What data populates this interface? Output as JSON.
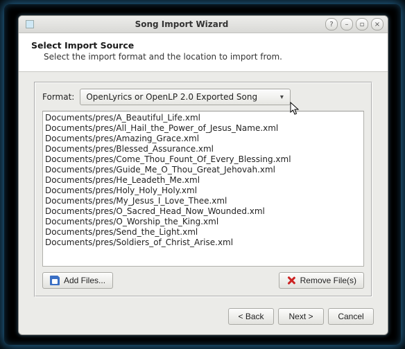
{
  "window": {
    "title": "Song Import Wizard"
  },
  "header": {
    "heading": "Select Import Source",
    "description": "Select the import format and the location to import from."
  },
  "format": {
    "label": "Format:",
    "selected": "OpenLyrics or OpenLP 2.0 Exported Song"
  },
  "files": [
    "Documents/pres/A_Beautiful_Life.xml",
    "Documents/pres/All_Hail_the_Power_of_Jesus_Name.xml",
    "Documents/pres/Amazing_Grace.xml",
    "Documents/pres/Blessed_Assurance.xml",
    "Documents/pres/Come_Thou_Fount_Of_Every_Blessing.xml",
    "Documents/pres/Guide_Me_O_Thou_Great_Jehovah.xml",
    "Documents/pres/He_Leadeth_Me.xml",
    "Documents/pres/Holy_Holy_Holy.xml",
    "Documents/pres/My_Jesus_I_Love_Thee.xml",
    "Documents/pres/O_Sacred_Head_Now_Wounded.xml",
    "Documents/pres/O_Worship_the_King.xml",
    "Documents/pres/Send_the_Light.xml",
    "Documents/pres/Soldiers_of_Christ_Arise.xml"
  ],
  "buttons": {
    "add_files": "Add Files...",
    "remove_files": "Remove File(s)",
    "back": "< Back",
    "next": "Next >",
    "cancel": "Cancel"
  },
  "winbtns": {
    "help": "?",
    "min": "–",
    "max": "▫",
    "close": "×"
  }
}
